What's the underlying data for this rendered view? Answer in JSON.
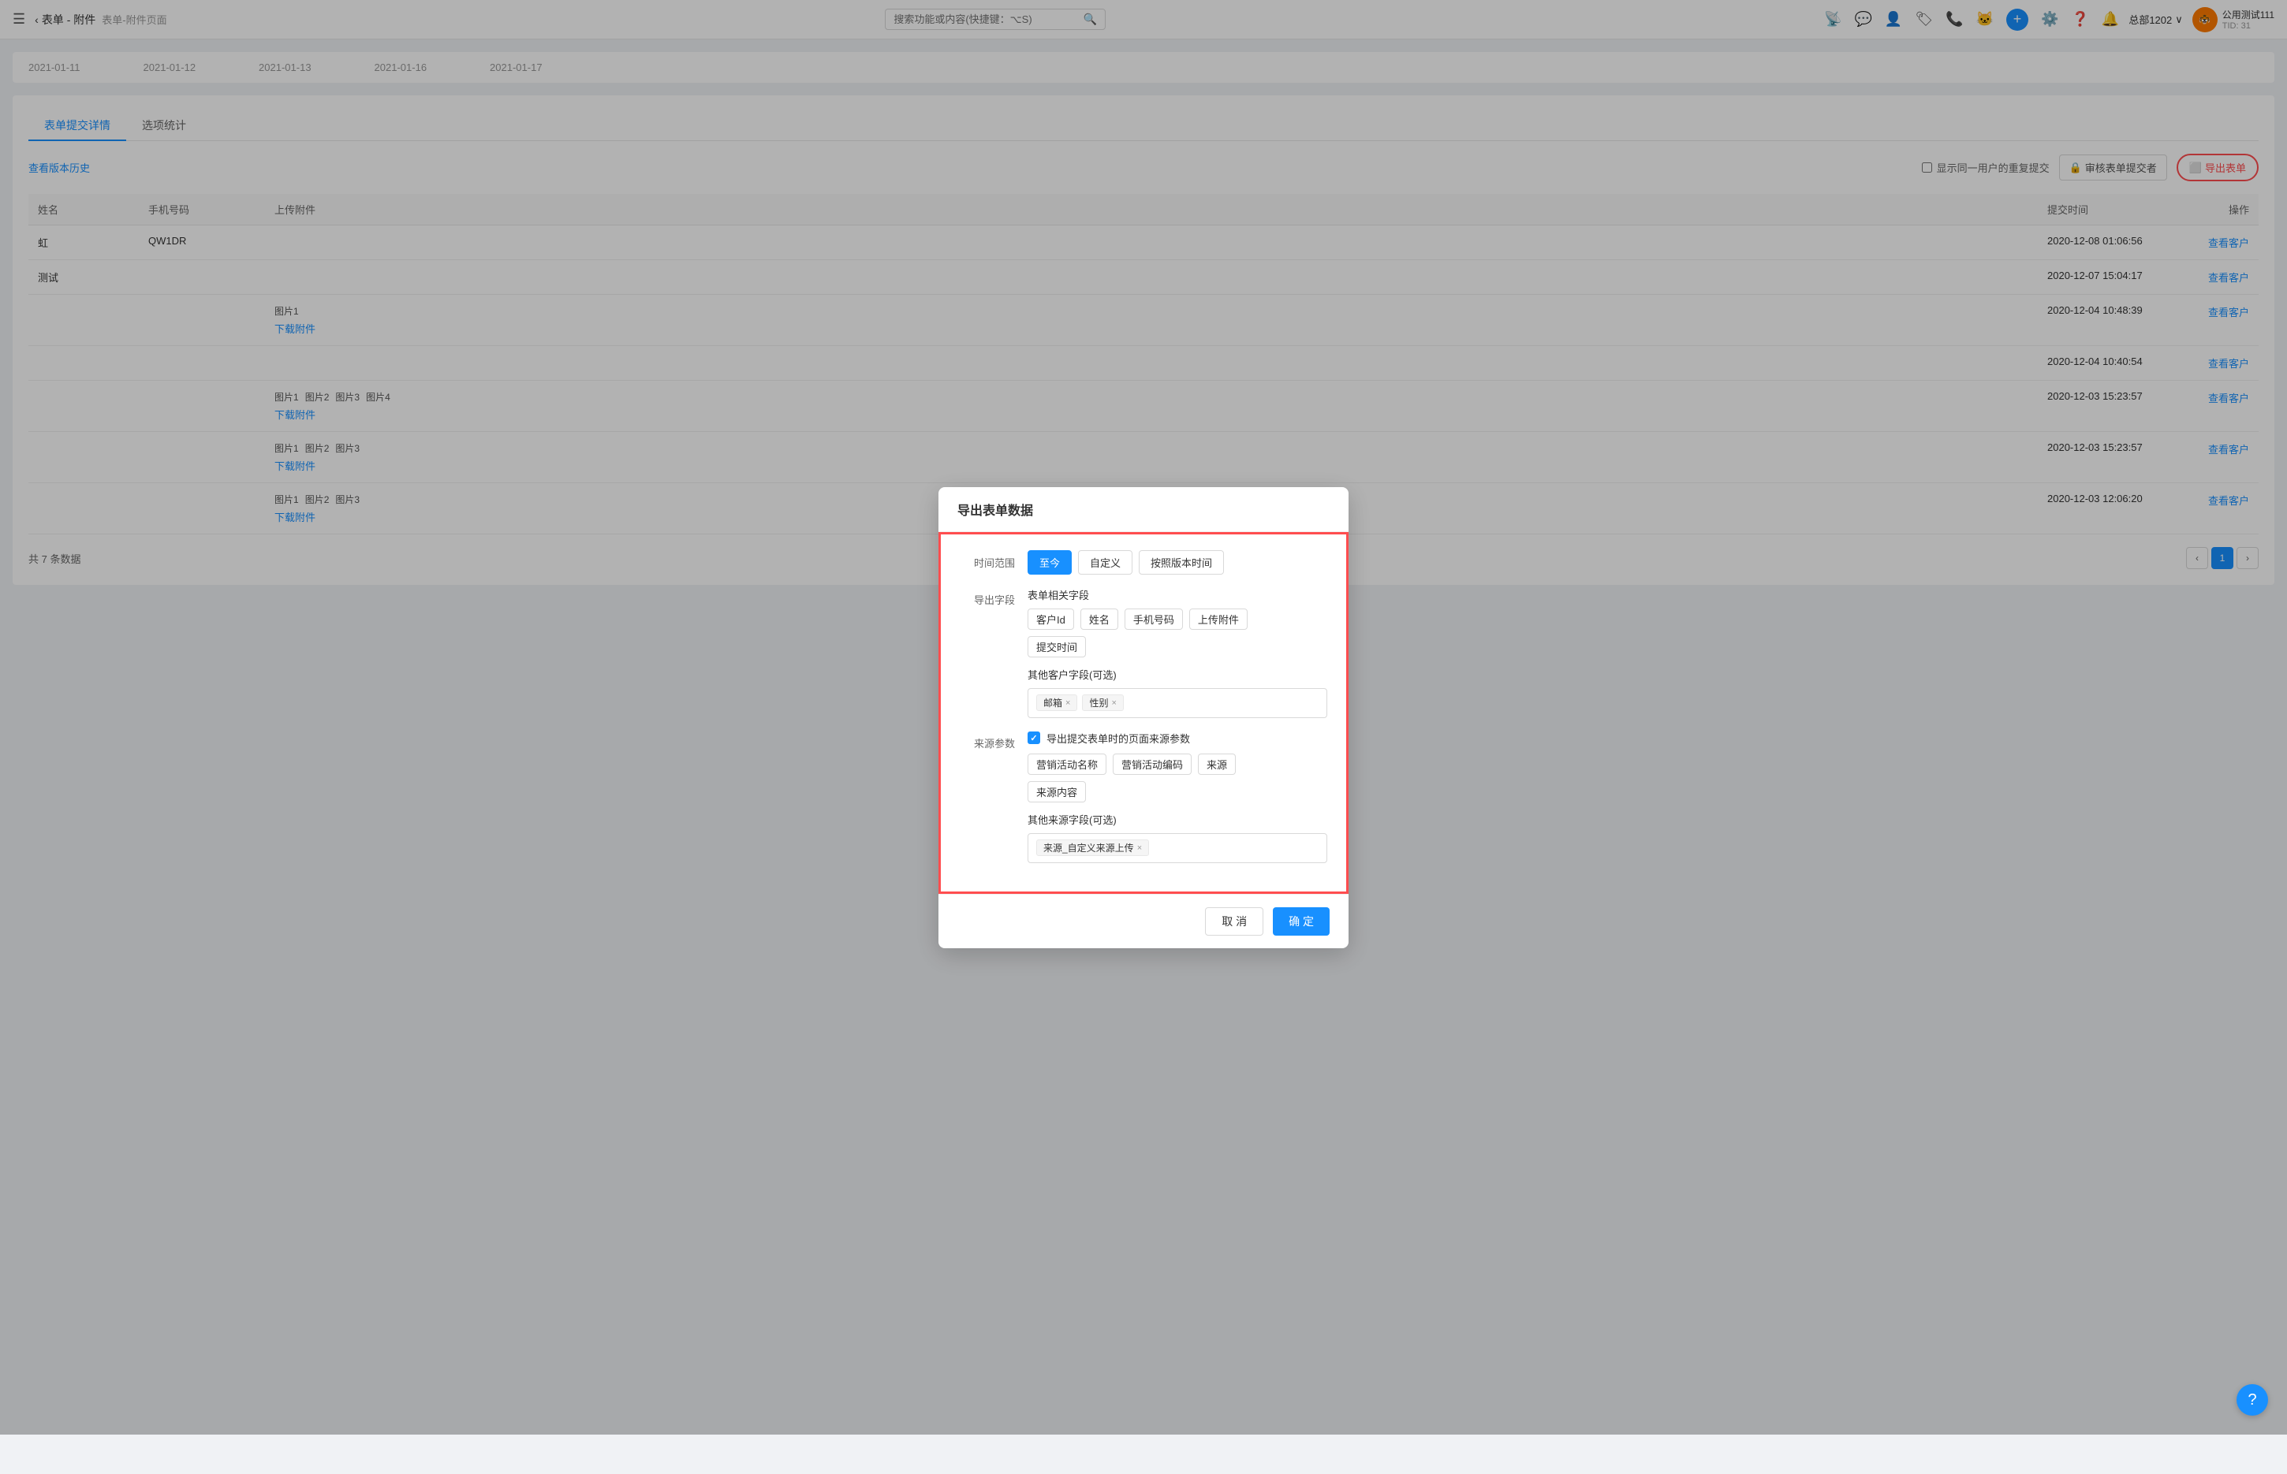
{
  "header": {
    "menu_icon": "☰",
    "back_label": "表单 - 附件",
    "page_name": "表单-附件页面",
    "search_placeholder": "搜索功能或内容(快捷键：⌥S)",
    "plus_icon": "+",
    "org_label": "总部1202",
    "user_name": "公用测试111",
    "user_tid": "TID: 31"
  },
  "timeline": {
    "dates": [
      "2021-01-11",
      "2021-01-12",
      "2021-01-13",
      "2021-01-16",
      "2021-01-17"
    ]
  },
  "tabs": [
    {
      "label": "表单提交详情",
      "active": true
    },
    {
      "label": "选项统计",
      "active": false
    }
  ],
  "toolbar": {
    "history_label": "查看版本历史",
    "duplicate_label": "显示同一用户的重复提交",
    "review_label": "审核表单提交者",
    "export_label": "导出表单"
  },
  "table": {
    "columns": [
      "姓名",
      "手机号码",
      "上传附件",
      "提交时间",
      "操作"
    ],
    "rows": [
      {
        "name": "虹",
        "phone": "QW1DR",
        "upload": "",
        "time": "2020-12-08 01:06:56",
        "action": "查看客户"
      },
      {
        "name": "测试",
        "phone": "",
        "upload": "",
        "time": "2020-12-07 15:04:17",
        "action": "查看客户"
      },
      {
        "name": "",
        "phone": "",
        "upload_images": [
          "图片1"
        ],
        "upload_link": "下载附件",
        "time": "2020-12-04 10:48:39",
        "action": "查看客户"
      },
      {
        "name": "",
        "phone": "",
        "upload": "",
        "time": "2020-12-04 10:40:54",
        "action": "查看客户"
      },
      {
        "name": "",
        "phone": "",
        "upload_images": [
          "图片1",
          "图片2",
          "图片3",
          "图片4"
        ],
        "upload_link": "下载附件",
        "time": "2020-12-03 15:23:57",
        "action": "查看客户"
      },
      {
        "name": "",
        "phone": "",
        "upload_images": [
          "图片1",
          "图片2",
          "图片3"
        ],
        "upload_link": "下载附件",
        "time": "2020-12-03 15:23:57",
        "action": "查看客户"
      },
      {
        "name": "",
        "phone": "",
        "upload_images": [
          "图片1",
          "图片2",
          "图片3"
        ],
        "upload_link": "下载附件",
        "time": "2020-12-03 12:06:20",
        "action": "查看客户"
      }
    ]
  },
  "footer": {
    "total_label": "共 7 条数据"
  },
  "dialog": {
    "title": "导出表单数据",
    "time_range_label": "时间范围",
    "time_options": [
      {
        "label": "至今",
        "active": true
      },
      {
        "label": "自定义",
        "active": false
      },
      {
        "label": "按照版本时间",
        "active": false
      }
    ],
    "export_field_label": "导出字段",
    "form_fields_title": "表单相关字段",
    "form_fields": [
      "客户Id",
      "姓名",
      "手机号码",
      "上传附件",
      "提交时间"
    ],
    "other_customer_title": "其他客户字段(可选)",
    "other_customer_tags": [
      {
        "label": "邮箱",
        "removable": true
      },
      {
        "label": "性别",
        "removable": true
      }
    ],
    "source_param_label": "来源参数",
    "source_checkbox_label": "导出提交表单时的页面来源参数",
    "source_checked": true,
    "source_fields": [
      "营销活动名称",
      "营销活动编码",
      "来源",
      "来源内容"
    ],
    "other_source_title": "其他来源字段(可选)",
    "other_source_tags": [
      {
        "label": "来源_自定义来源上传",
        "removable": true
      }
    ],
    "cancel_label": "取 消",
    "confirm_label": "确 定"
  },
  "support_icon": "?"
}
